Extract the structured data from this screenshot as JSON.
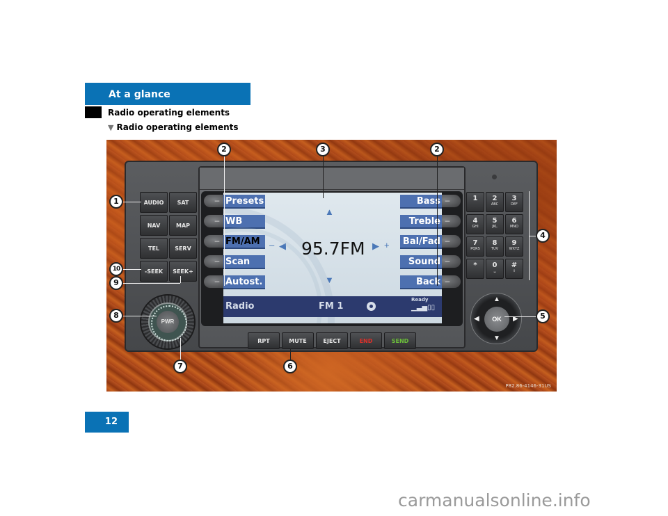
{
  "header": {
    "title": "At a glance"
  },
  "section": {
    "title": "Radio operating elements",
    "subsection": "Radio operating elements"
  },
  "figure": {
    "code": "P82.86-4146-31US",
    "left_buttons": [
      "AUDIO",
      "SAT",
      "NAV",
      "MAP",
      "TEL",
      "SERV",
      "-SEEK",
      "SEEK+"
    ],
    "screen": {
      "left_softkeys": [
        "Presets",
        "WB",
        "FM/AM",
        "Scan",
        "Autost."
      ],
      "active_softkey": "FM/AM",
      "right_softkeys": [
        "Bass",
        "Treble",
        "Bal/Fad",
        "Sound",
        "Back"
      ],
      "frequency": "95.7FM",
      "minus": "–",
      "plus": "+",
      "status": {
        "mode": "Radio",
        "band": "FM 1",
        "ready": "Ready",
        "signal": "▁▃▅▯▯"
      }
    },
    "side_button_glyph": "–",
    "keypad": [
      {
        "main": "1",
        "sub": ""
      },
      {
        "main": "2",
        "sub": "ABC"
      },
      {
        "main": "3",
        "sub": "DEF"
      },
      {
        "main": "4",
        "sub": "GHI"
      },
      {
        "main": "5",
        "sub": "JKL"
      },
      {
        "main": "6",
        "sub": "MNO"
      },
      {
        "main": "7",
        "sub": "PQRS"
      },
      {
        "main": "8",
        "sub": "TUV"
      },
      {
        "main": "9",
        "sub": "WXYZ"
      },
      {
        "main": "*",
        "sub": ""
      },
      {
        "main": "0",
        "sub": "␣"
      },
      {
        "main": "#",
        "sub": "⇧"
      }
    ],
    "bottom_buttons": [
      {
        "label": "RPT",
        "color": "#e6e6e6"
      },
      {
        "label": "MUTE",
        "color": "#e6e6e6"
      },
      {
        "label": "EJECT",
        "color": "#e6e6e6"
      },
      {
        "label": "END",
        "color": "#e0302a"
      },
      {
        "label": "SEND",
        "color": "#6cbf3a"
      }
    ],
    "pwr_label": "PWR",
    "ok_label": "OK",
    "callouts": [
      "1",
      "2",
      "2",
      "3",
      "4",
      "5",
      "6",
      "7",
      "8",
      "9",
      "10"
    ]
  },
  "footer": {
    "page_number": "12",
    "watermark": "carmanualsonline.info"
  }
}
